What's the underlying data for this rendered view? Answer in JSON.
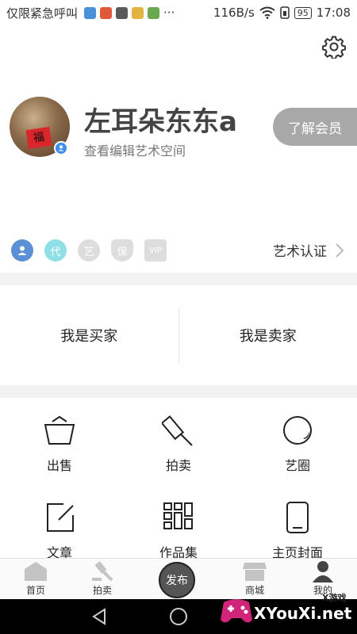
{
  "status_bar": {
    "carrier": "仅限紧急呼叫",
    "speed": "116B/s",
    "battery": "95",
    "time": "17:08",
    "app_icon_colors": [
      "#4a90d9",
      "#e05a3a",
      "#5a5a5a",
      "#e3b341",
      "#6aa84f"
    ]
  },
  "profile": {
    "username": "左耳朵东东a",
    "edit_link": "查看编辑艺术空间",
    "vip_button": "了解会员",
    "certification": "艺术认证",
    "badges": [
      {
        "name": "user",
        "text": "",
        "color": "#5b8fd6"
      },
      {
        "name": "agent",
        "text": "代",
        "color": "#8ee0e6"
      },
      {
        "name": "art",
        "text": "艺",
        "color": "#dddddd"
      },
      {
        "name": "guarantee",
        "text": "保",
        "color": "#dddddd"
      },
      {
        "name": "vip",
        "text": "VIP",
        "color": "#dddddd"
      }
    ]
  },
  "roles": {
    "buyer": "我是买家",
    "seller": "我是卖家"
  },
  "grid": {
    "items": [
      {
        "label": "出售",
        "icon": "basket-icon"
      },
      {
        "label": "拍卖",
        "icon": "gavel-icon"
      },
      {
        "label": "艺圈",
        "icon": "circle-icon"
      },
      {
        "label": "文章",
        "icon": "edit-icon"
      },
      {
        "label": "作品集",
        "icon": "grid-icon"
      },
      {
        "label": "主页封面",
        "icon": "phone-icon"
      }
    ]
  },
  "tabbar": {
    "home": "首页",
    "auction": "拍卖",
    "publish": "发布",
    "mall": "商城",
    "mine": "我的"
  },
  "watermark": {
    "text": "XYouXi.net",
    "small": "X游戏"
  }
}
